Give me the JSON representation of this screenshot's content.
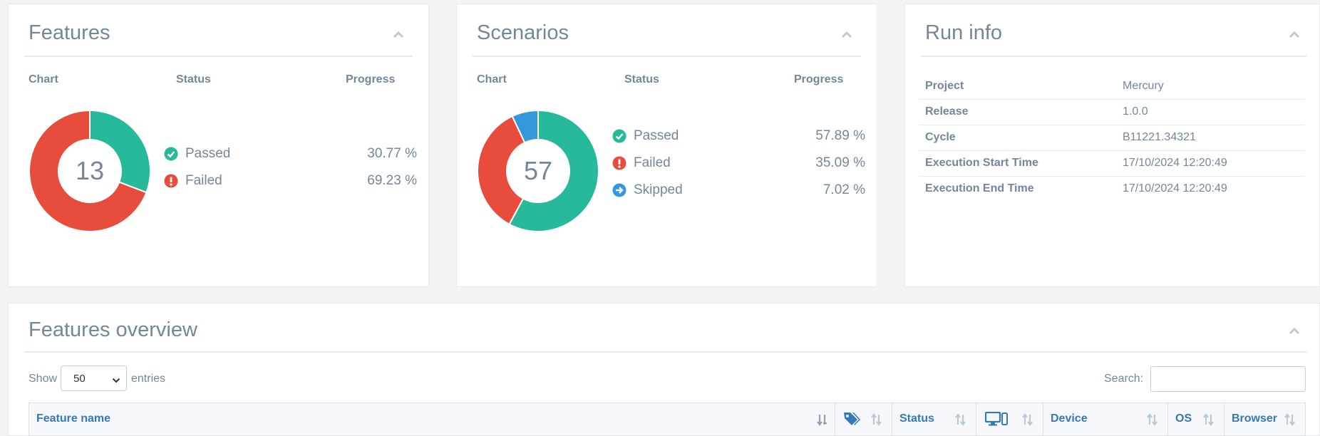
{
  "features": {
    "title": "Features",
    "columns": {
      "chart": "Chart",
      "status": "Status",
      "progress": "Progress"
    },
    "total": "13",
    "items": [
      {
        "name": "Passed",
        "value": "30.77 %",
        "percent": 30.77,
        "color": "#26b99a",
        "icon": "check-circle-icon"
      },
      {
        "name": "Failed",
        "value": "69.23 %",
        "percent": 69.23,
        "color": "#e74c3c",
        "icon": "exclamation-circle-icon"
      }
    ]
  },
  "scenarios": {
    "title": "Scenarios",
    "columns": {
      "chart": "Chart",
      "status": "Status",
      "progress": "Progress"
    },
    "total": "57",
    "items": [
      {
        "name": "Passed",
        "value": "57.89 %",
        "percent": 57.89,
        "color": "#26b99a",
        "icon": "check-circle-icon"
      },
      {
        "name": "Failed",
        "value": "35.09 %",
        "percent": 35.09,
        "color": "#e74c3c",
        "icon": "exclamation-circle-icon"
      },
      {
        "name": "Skipped",
        "value": "7.02 %",
        "percent": 7.02,
        "color": "#3498db",
        "icon": "arrow-circle-right-icon"
      }
    ]
  },
  "run_info": {
    "title": "Run info",
    "rows": [
      {
        "key": "Project",
        "value": "Mercury"
      },
      {
        "key": "Release",
        "value": "1.0.0"
      },
      {
        "key": "Cycle",
        "value": "B11221.34321"
      },
      {
        "key": "Execution Start Time",
        "value": "17/10/2024 12:20:49"
      },
      {
        "key": "Execution End Time",
        "value": "17/10/2024 12:20:49"
      }
    ]
  },
  "overview": {
    "title": "Features overview",
    "show_label": "Show",
    "entries_label": "entries",
    "page_size": "50",
    "search_label": "Search:",
    "search_value": "",
    "columns": {
      "feature_name": "Feature name",
      "tags_icon": "tags-icon",
      "status": "Status",
      "device_icon": "desktop-mobile-icon",
      "device": "Device",
      "os": "OS",
      "browser": "Browser"
    }
  }
}
